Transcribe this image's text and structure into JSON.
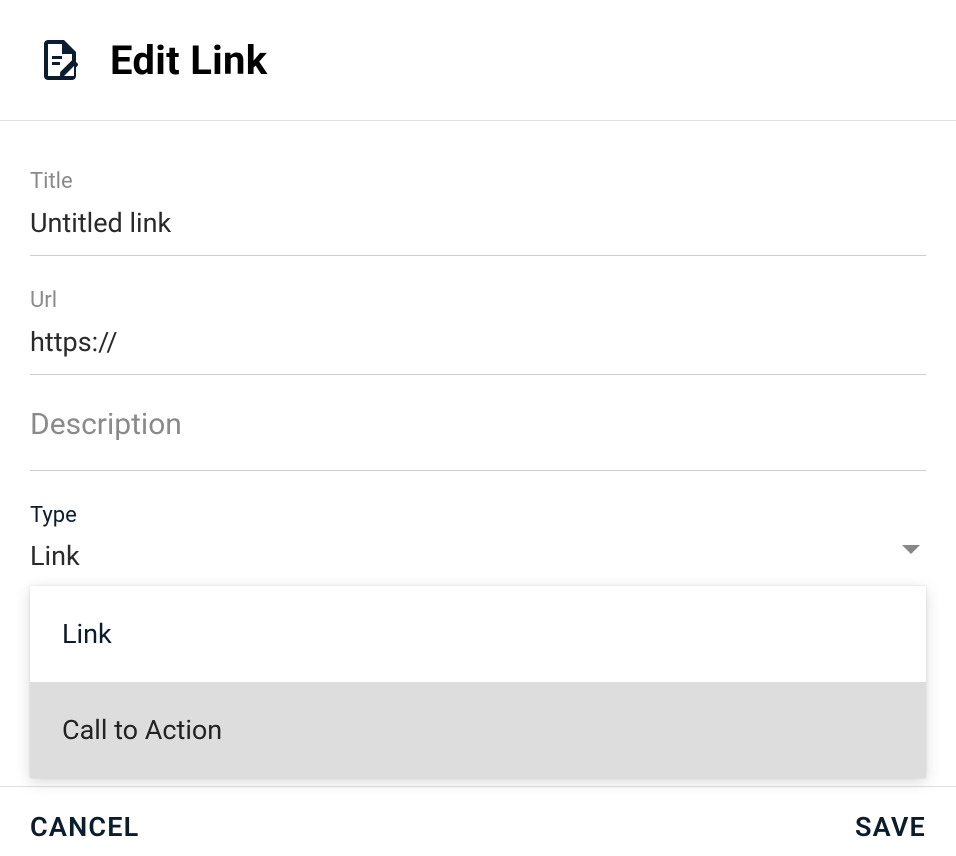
{
  "dialog": {
    "title": "Edit Link"
  },
  "fields": {
    "title": {
      "label": "Title",
      "value": "Untitled link"
    },
    "url": {
      "label": "Url",
      "value": "https://"
    },
    "description": {
      "placeholder": "Description",
      "value": ""
    },
    "type": {
      "label": "Type",
      "value": "Link",
      "options": [
        {
          "label": "Link",
          "selected": true
        },
        {
          "label": "Call to Action",
          "selected": false
        }
      ]
    }
  },
  "actions": {
    "cancel": "CANCEL",
    "save": "SAVE"
  }
}
